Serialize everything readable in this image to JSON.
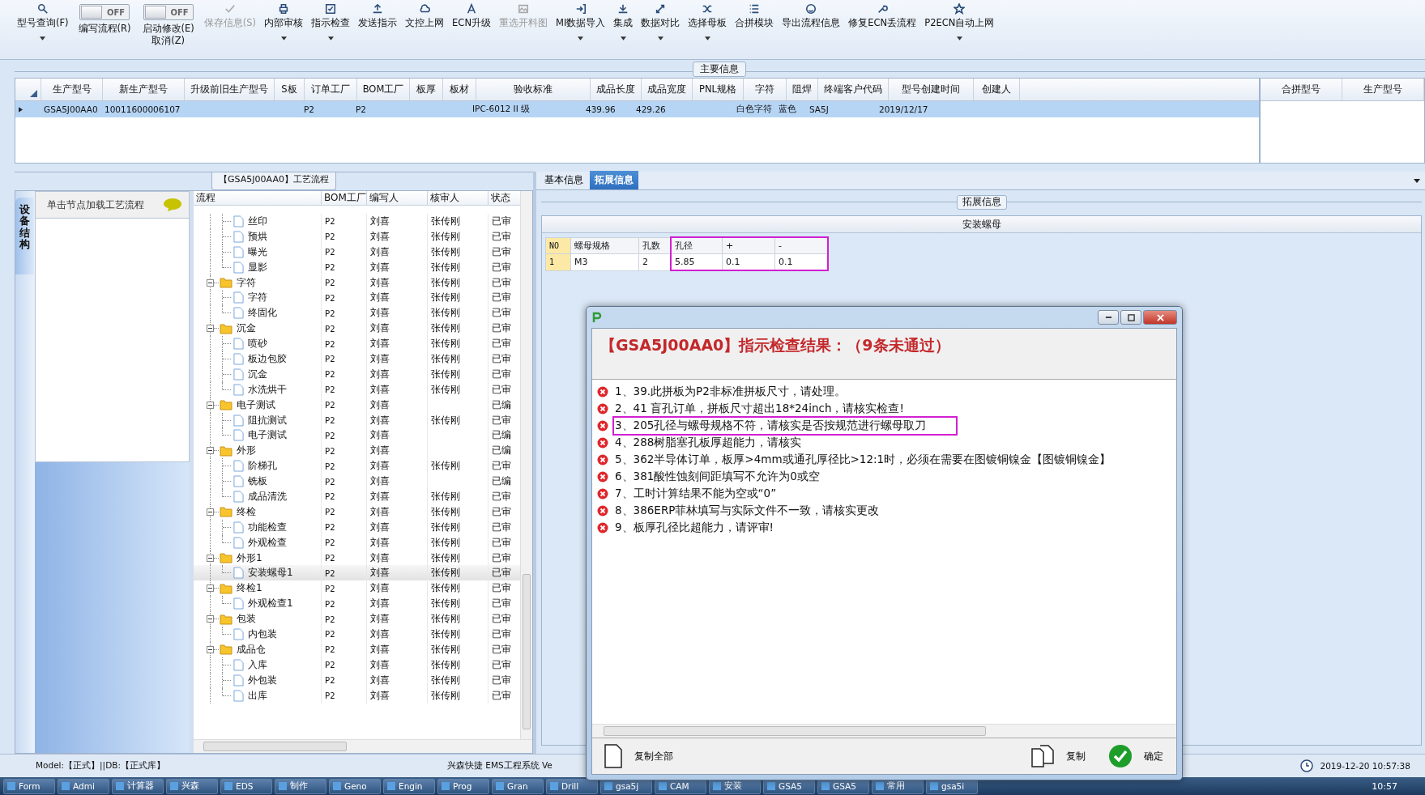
{
  "toolbar": [
    {
      "kind": "button",
      "label": "型号查询(F)",
      "dropdown": true,
      "disabled": false
    },
    {
      "kind": "toggle",
      "label": "编写流程(R)",
      "state_text": "OFF",
      "on": false
    },
    {
      "kind": "toggle",
      "label": "启动修改(E)\n取消(Z)",
      "state_text": "OFF",
      "on": false
    },
    {
      "kind": "button",
      "label": "保存信息(S)",
      "dropdown": false,
      "disabled": true
    },
    {
      "kind": "button",
      "label": "内部审核",
      "dropdown": true,
      "disabled": false
    },
    {
      "kind": "button",
      "label": "指示检查",
      "dropdown": true,
      "disabled": false
    },
    {
      "kind": "button",
      "label": "发送指示",
      "dropdown": false,
      "disabled": false
    },
    {
      "kind": "button",
      "label": "文控上网",
      "dropdown": false,
      "disabled": false
    },
    {
      "kind": "button",
      "label": "ECN升级",
      "dropdown": false,
      "disabled": false
    },
    {
      "kind": "button",
      "label": "重选开料图",
      "dropdown": false,
      "disabled": true
    },
    {
      "kind": "button",
      "label": "MI数据导入",
      "dropdown": true,
      "disabled": false
    },
    {
      "kind": "button",
      "label": "集成",
      "dropdown": true,
      "disabled": false
    },
    {
      "kind": "button",
      "label": "数据对比",
      "dropdown": true,
      "disabled": false
    },
    {
      "kind": "button",
      "label": "选择母板",
      "dropdown": true,
      "disabled": false
    },
    {
      "kind": "button",
      "label": "合拼模块",
      "dropdown": false,
      "disabled": false
    },
    {
      "kind": "button",
      "label": "导出流程信息",
      "dropdown": false,
      "disabled": false
    },
    {
      "kind": "button",
      "label": "修复ECN丢流程",
      "dropdown": false,
      "disabled": false
    },
    {
      "kind": "button",
      "label": "P2ECN自动上网",
      "dropdown": true,
      "disabled": false
    }
  ],
  "main_info": {
    "title": "主要信息",
    "columns": [
      "生产型号",
      "新生产型号",
      "升级前旧生产型号",
      "S板",
      "订单工厂",
      "BOM工厂",
      "板厚",
      "板材",
      "验收标准",
      "成品长度",
      "成品宽度",
      "PNL规格",
      "字符",
      "阻焊",
      "终端客户代码",
      "型号创建时间",
      "创建人"
    ],
    "rows": [
      {
        "selected": true,
        "cells": [
          "GSA5J00AA0",
          "10011600006107",
          null,
          null,
          "P2",
          "P2",
          null,
          null,
          "IPC-6012 II 级",
          "439.96",
          "429.26",
          null,
          "白色字符",
          "蓝色",
          "SA5J",
          "2019/12/17",
          null
        ]
      }
    ],
    "side_columns": [
      "合拼型号",
      "生产型号"
    ]
  },
  "process": {
    "title": "【GSA5J00AA0】工艺流程",
    "side_tab": "设备结构",
    "hint": "单击节点加载工艺流程",
    "columns": [
      "流程",
      "BOM工厂",
      "编写人",
      "核审人",
      "状态"
    ]
  },
  "tree": {
    "continued": [
      {
        "label": "丝印",
        "bom": "P2",
        "writer": "刘喜",
        "reviewer": "张传刚",
        "status": "已审",
        "selected": false
      },
      {
        "label": "预烘",
        "bom": "P2",
        "writer": "刘喜",
        "reviewer": "张传刚",
        "status": "已审",
        "selected": false
      },
      {
        "label": "曝光",
        "bom": "P2",
        "writer": "刘喜",
        "reviewer": "张传刚",
        "status": "已审",
        "selected": false
      },
      {
        "label": "显影",
        "bom": "P2",
        "writer": "刘喜",
        "reviewer": "张传刚",
        "status": "已审",
        "selected": false
      }
    ],
    "nodes": [
      {
        "label": "字符",
        "bom": "P2",
        "writer": "刘喜",
        "reviewer": "张传刚",
        "status": "已审",
        "selected": false,
        "expanded": true,
        "children": [
          {
            "label": "字符",
            "bom": "P2",
            "writer": "刘喜",
            "reviewer": "张传刚",
            "status": "已审",
            "selected": false
          },
          {
            "label": "终固化",
            "bom": "P2",
            "writer": "刘喜",
            "reviewer": "张传刚",
            "status": "已审",
            "selected": false
          }
        ]
      },
      {
        "label": "沉金",
        "bom": "P2",
        "writer": "刘喜",
        "reviewer": "张传刚",
        "status": "已审",
        "selected": false,
        "expanded": true,
        "children": [
          {
            "label": "喷砂",
            "bom": "P2",
            "writer": "刘喜",
            "reviewer": "张传刚",
            "status": "已审",
            "selected": false
          },
          {
            "label": "板边包胶",
            "bom": "P2",
            "writer": "刘喜",
            "reviewer": "张传刚",
            "status": "已审",
            "selected": false
          },
          {
            "label": "沉金",
            "bom": "P2",
            "writer": "刘喜",
            "reviewer": "张传刚",
            "status": "已审",
            "selected": false
          },
          {
            "label": "水洗烘干",
            "bom": "P2",
            "writer": "刘喜",
            "reviewer": "张传刚",
            "status": "已审",
            "selected": false
          }
        ]
      },
      {
        "label": "电子测试",
        "bom": "P2",
        "writer": "刘喜",
        "status": "已编",
        "selected": false,
        "expanded": true,
        "children": [
          {
            "label": "阻抗测试",
            "bom": "P2",
            "writer": "刘喜",
            "reviewer": "张传刚",
            "status": "已审",
            "selected": false
          },
          {
            "label": "电子测试",
            "bom": "P2",
            "writer": "刘喜",
            "status": "已编",
            "selected": false
          }
        ]
      },
      {
        "label": "外形",
        "bom": "P2",
        "writer": "刘喜",
        "status": "已编",
        "selected": false,
        "expanded": true,
        "children": [
          {
            "label": "阶梯孔",
            "bom": "P2",
            "writer": "刘喜",
            "reviewer": "张传刚",
            "status": "已审",
            "selected": false
          },
          {
            "label": "铣板",
            "bom": "P2",
            "writer": "刘喜",
            "status": "已编",
            "selected": false
          },
          {
            "label": "成品清洗",
            "bom": "P2",
            "writer": "刘喜",
            "reviewer": "张传刚",
            "status": "已审",
            "selected": false
          }
        ]
      },
      {
        "label": "终检",
        "bom": "P2",
        "writer": "刘喜",
        "reviewer": "张传刚",
        "status": "已审",
        "selected": false,
        "expanded": true,
        "children": [
          {
            "label": "功能检查",
            "bom": "P2",
            "writer": "刘喜",
            "reviewer": "张传刚",
            "status": "已审",
            "selected": false
          },
          {
            "label": "外观检查",
            "bom": "P2",
            "writer": "刘喜",
            "reviewer": "张传刚",
            "status": "已审",
            "selected": false
          }
        ]
      },
      {
        "label": "外形1",
        "bom": "P2",
        "writer": "刘喜",
        "reviewer": "张传刚",
        "status": "已审",
        "selected": false,
        "expanded": true,
        "children": [
          {
            "label": "安装螺母1",
            "bom": "P2",
            "writer": "刘喜",
            "reviewer": "张传刚",
            "status": "已审",
            "selected": true
          }
        ]
      },
      {
        "label": "终检1",
        "bom": "P2",
        "writer": "刘喜",
        "reviewer": "张传刚",
        "status": "已审",
        "selected": false,
        "expanded": true,
        "children": [
          {
            "label": "外观检查1",
            "bom": "P2",
            "writer": "刘喜",
            "reviewer": "张传刚",
            "status": "已审",
            "selected": false
          }
        ]
      },
      {
        "label": "包装",
        "bom": "P2",
        "writer": "刘喜",
        "reviewer": "张传刚",
        "status": "已审",
        "selected": false,
        "expanded": true,
        "children": [
          {
            "label": "内包装",
            "bom": "P2",
            "writer": "刘喜",
            "reviewer": "张传刚",
            "status": "已审",
            "selected": false
          }
        ]
      },
      {
        "label": "成品仓",
        "bom": "P2",
        "writer": "刘喜",
        "reviewer": "张传刚",
        "status": "已审",
        "selected": false,
        "expanded": true,
        "children": [
          {
            "label": "入库",
            "bom": "P2",
            "writer": "刘喜",
            "reviewer": "张传刚",
            "status": "已审",
            "selected": false
          },
          {
            "label": "外包装",
            "bom": "P2",
            "writer": "刘喜",
            "reviewer": "张传刚",
            "status": "已审",
            "selected": false
          },
          {
            "label": "出库",
            "bom": "P2",
            "writer": "刘喜",
            "reviewer": "张传刚",
            "status": "已审",
            "selected": false
          }
        ]
      }
    ]
  },
  "detail_tabs": [
    {
      "label": "基本信息",
      "selected": false
    },
    {
      "label": "拓展信息",
      "selected": true
    }
  ],
  "extension": {
    "title": "拓展信息",
    "table_title": "安装螺母",
    "columns": [
      {
        "label": "NO",
        "highlighted": false
      },
      {
        "label": "螺母规格",
        "highlighted": false
      },
      {
        "label": "孔数",
        "highlighted": false
      },
      {
        "label": "孔径",
        "highlighted": true
      },
      {
        "label": "+",
        "highlighted": true
      },
      {
        "label": "-",
        "highlighted": true
      }
    ],
    "rows": [
      [
        "1",
        "M3",
        "2",
        "5.85",
        "0.1",
        "0.1"
      ]
    ]
  },
  "dialog": {
    "heading": "【GSA5J00AA0】指示检查结果：（9条未通过）",
    "messages": [
      {
        "text": "1、39.此拼板为P2非标准拼板尺寸，请处理。",
        "highlighted": false
      },
      {
        "text": "2、41 盲孔订单，拼板尺寸超出18*24inch，请核实检查!",
        "highlighted": false
      },
      {
        "text": "3、205孔径与螺母规格不符，请核实是否按规范进行螺母取刀",
        "highlighted": true
      },
      {
        "text": "4、288树脂塞孔板厚超能力，请核实",
        "highlighted": false
      },
      {
        "text": "5、362半导体订单，板厚>4mm或通孔厚径比>12:1时，必须在需要在图镀铜镍金【图镀铜镍金】",
        "highlighted": false
      },
      {
        "text": "6、381酸性蚀刻间距填写不允许为0或空",
        "highlighted": false
      },
      {
        "text": "7、工时计算结果不能为空或“0”",
        "highlighted": false
      },
      {
        "text": "8、386ERP菲林填写与实际文件不一致，请核实更改",
        "highlighted": false
      },
      {
        "text": "9、板厚孔径比超能力，请评审!",
        "highlighted": false
      }
    ],
    "buttons": [
      {
        "kind": "copy_all",
        "label": "复制全部"
      },
      {
        "kind": "copy",
        "label": "复制"
      },
      {
        "kind": "ok",
        "label": "确定"
      }
    ]
  },
  "status_bar": {
    "db": "Model:【正式】||DB:【正式库】",
    "system": "兴森快捷 EMS工程系统 Ve",
    "clock": "2019-12-20 10:57:38"
  },
  "taskbar": {
    "items": [
      "Form",
      "Admi",
      "计算器",
      "兴森",
      "EDS",
      "制作",
      "Geno",
      "Engin",
      "Prog",
      "Gran",
      "Drill",
      "gsa5j",
      "CAM",
      "安装",
      "GSA5",
      "GSA5",
      "常用",
      "gsa5i"
    ],
    "time": "10:57"
  }
}
